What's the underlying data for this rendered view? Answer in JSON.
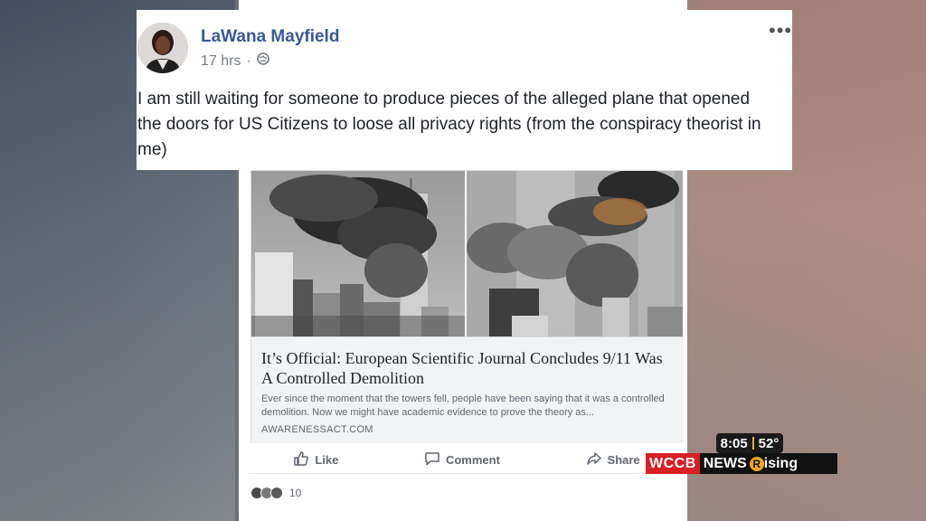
{
  "post": {
    "author": "LaWana Mayfield",
    "time": "17 hrs",
    "separator": "·",
    "more_label": "•••",
    "text": "I am still waiting for someone to produce pieces of the alleged plane that opened the doors for US Citizens to loose all privacy rights (from the conspiracy theorist in me)"
  },
  "link": {
    "title": "It’s Official: European Scientific Journal Concludes 9/11 Was A Controlled Demolition",
    "description": "Ever since the moment that the towers fell, people have been saying that it was a controlled demolition. Now we might have academic evidence to prove the theory as...",
    "domain": "AWARENESSACT.COM"
  },
  "actions": {
    "like": "Like",
    "comment": "Comment",
    "share": "Share"
  },
  "reactions": {
    "count": "10"
  },
  "news_bug": {
    "time": "8:05",
    "temp": "52°",
    "brand": "WCCB",
    "news": "NEWS",
    "rising": "ising",
    "rising_initial": "R"
  },
  "icons": {
    "globe": "globe-icon",
    "like": "thumbs-up-icon",
    "comment": "comment-bubble-icon",
    "share": "share-arrow-icon"
  },
  "colors": {
    "author": "#385898",
    "news_red": "#d81f26",
    "rising_gold": "#f0a81c"
  }
}
